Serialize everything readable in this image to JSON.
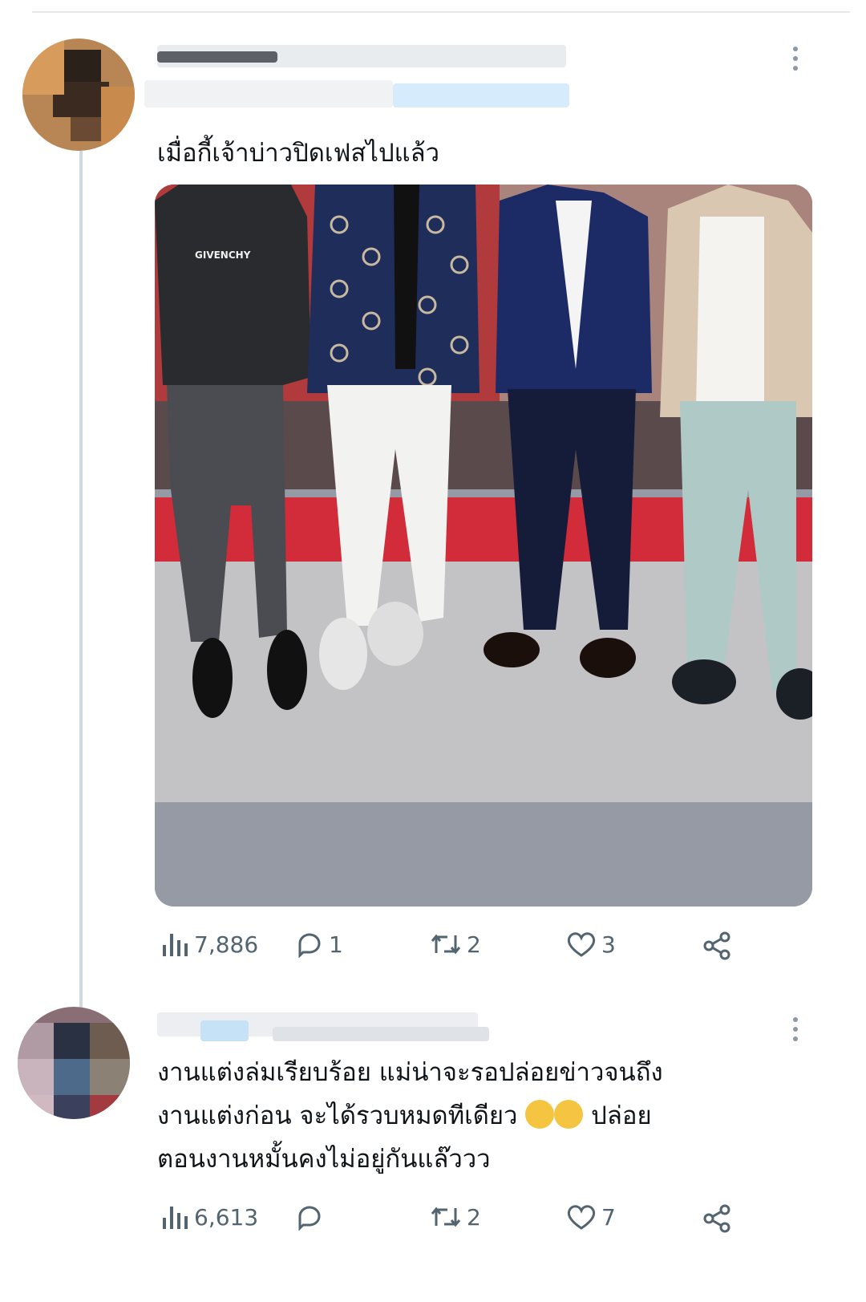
{
  "post1": {
    "text": "เมื่อกี้เจ้าบ่าวปิดเฟสไปแล้ว",
    "media_text": "GIVENCHY",
    "stats": {
      "views": "7,886",
      "replies": "1",
      "reposts": "2",
      "likes": "3"
    }
  },
  "post2": {
    "text_line1": "งานแต่งล่มเรียบร้อย แม่น่าจะรอปล่อยข่าวจนถึง",
    "text_line2_a": "งานแต่งก่อน จะได้รวบหมดทีเดียว",
    "text_line2_b": "ปล่อย",
    "text_line3": "ตอนงานหมั้นคงไม่อยู่กันแล๊ววว",
    "emoji": [
      "face-with-tears-of-joy",
      "rolling-on-the-floor-laughing"
    ],
    "stats": {
      "views": "6,613",
      "replies": "",
      "reposts": "2",
      "likes": "7"
    }
  },
  "colors": {
    "icon": "#536471",
    "thread_line": "#cfd9de",
    "link_blue": "#1d9bf0"
  }
}
